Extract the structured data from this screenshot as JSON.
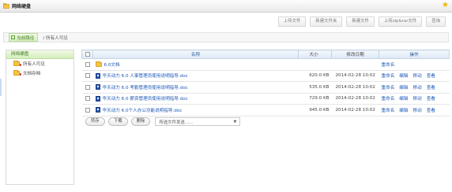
{
  "titlebar": {
    "title": "网络硬盘"
  },
  "toolbar": {
    "buttons": [
      "上传文件",
      "新建文件夹",
      "新建文件",
      "上传zip&rar文件",
      "查询"
    ]
  },
  "breadcrumb": {
    "tab_label": "当前路径",
    "path": "/ 所有人可见"
  },
  "sidebar": {
    "header": "网络硬盘",
    "items": [
      {
        "label": "所有人可见"
      },
      {
        "label": "文档存档"
      }
    ]
  },
  "table": {
    "headers": {
      "name": "名称",
      "size": "大小",
      "date": "修改日期",
      "ops": "操作"
    },
    "rows": [
      {
        "type": "folder",
        "name": "6.0文档",
        "size": "",
        "date": "",
        "ops": [
          "重命名"
        ]
      },
      {
        "type": "doc",
        "name": "华天动力 6.0 人事管理员使用说明指导.doc",
        "size": "620.0 KB",
        "date": "2014-02-28 10:02",
        "ops": [
          "重命名",
          "编辑",
          "移动",
          "查看"
        ]
      },
      {
        "type": "doc",
        "name": "华天动力 6.0 考勤管理员使用说明指导.doc",
        "size": "535.0 KB",
        "date": "2014-02-28 10:02",
        "ops": [
          "重命名",
          "编辑",
          "移动",
          "查看"
        ]
      },
      {
        "type": "doc",
        "name": "华天动力 6.0 薪资管理员使用说明指导.doc",
        "size": "729.0 KB",
        "date": "2014-02-28 10:02",
        "ops": [
          "重命名",
          "编辑",
          "移动",
          "查看"
        ]
      },
      {
        "type": "doc",
        "name": "华天动力 6.0个人办公功能说明指导.doc",
        "size": "945.0 KB",
        "date": "2014-02-28 10:02",
        "ops": [
          "重命名",
          "编辑",
          "移动",
          "查看"
        ]
      }
    ]
  },
  "actions": {
    "buttons": [
      "转存",
      "下载",
      "删除"
    ],
    "select_value": "所选文件发送......"
  },
  "colors": {
    "accent_green": "#3d7a1d",
    "link_blue": "#1b57b6",
    "header_blue": "#2b5b98",
    "star": "#f0b400"
  }
}
